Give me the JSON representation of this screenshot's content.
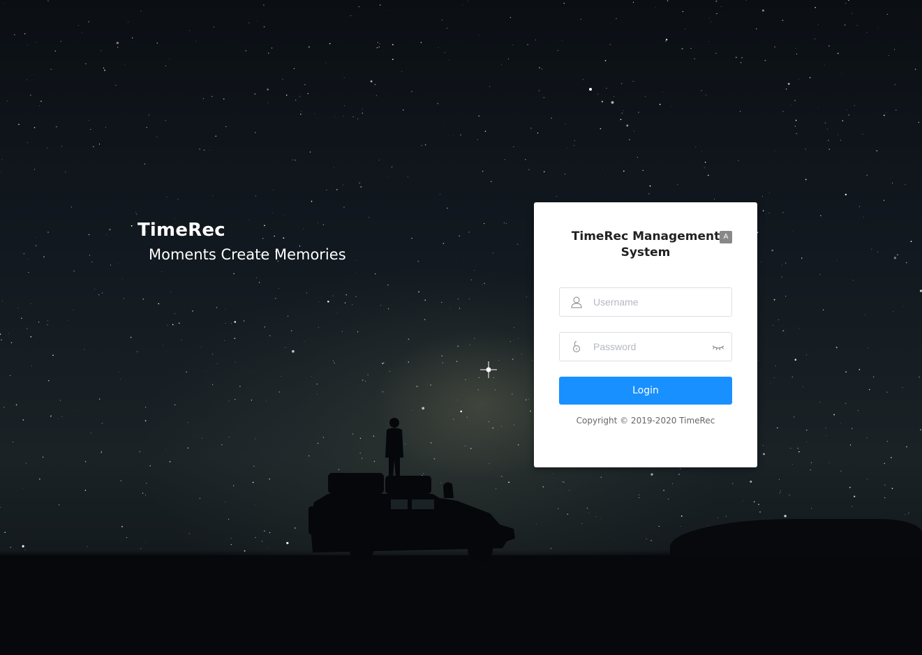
{
  "brand": {
    "name": "TimeRec",
    "slogan": "Moments Create Memories"
  },
  "login": {
    "title": "TimeRec Management System",
    "language_icon_label": "A",
    "username_placeholder": "Username",
    "password_placeholder": "Password",
    "login_label": "Login",
    "copyright": "Copyright © 2019-2020 TimeRec"
  },
  "icons": {
    "username": "user-icon",
    "password": "lock-icon",
    "toggle_password": "eye-closed-icon",
    "language": "translate-icon"
  },
  "colors": {
    "primary": "#1890ff",
    "card_bg": "#ffffff",
    "text_dark": "#222222",
    "placeholder": "#b4b8c0"
  }
}
